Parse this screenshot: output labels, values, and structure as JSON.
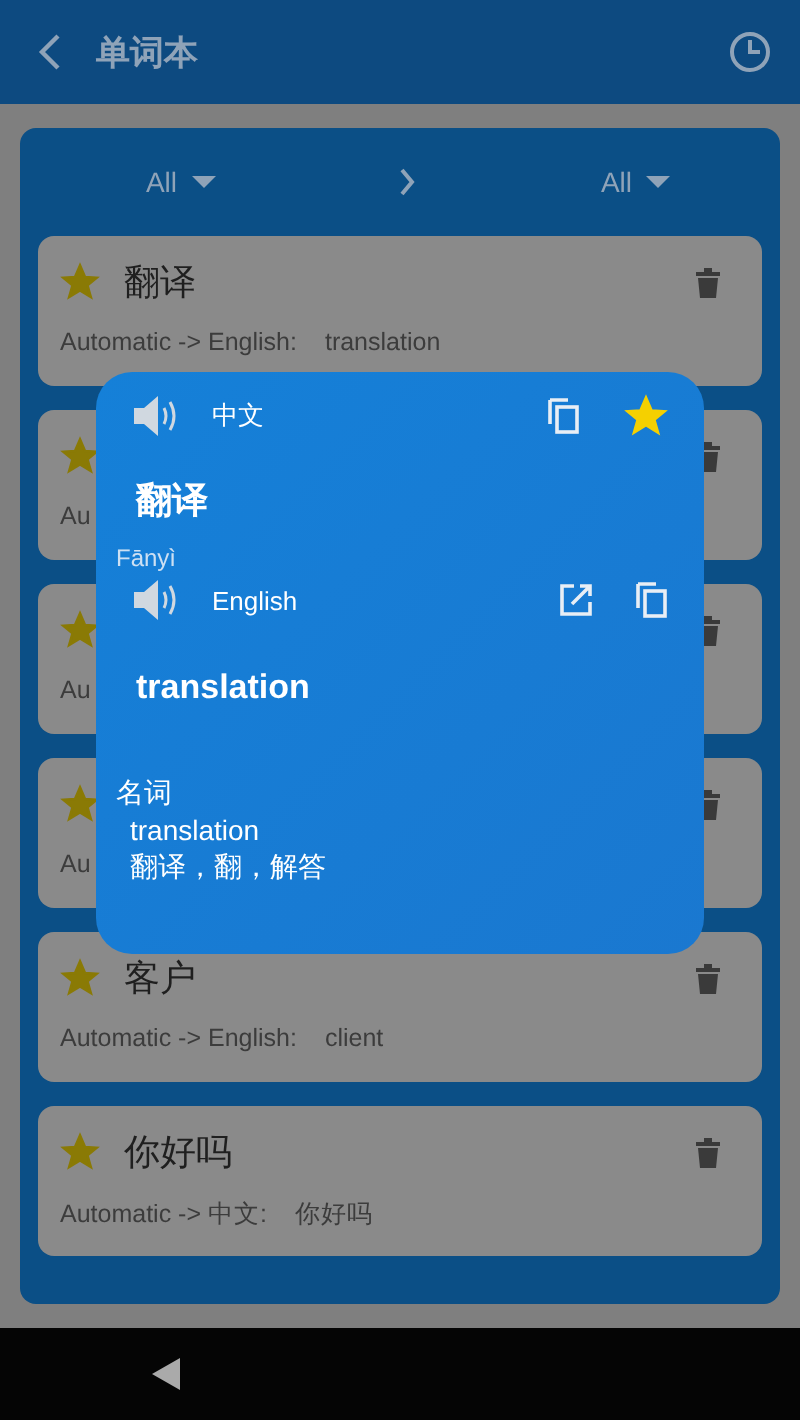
{
  "header": {
    "title": "单词本"
  },
  "filter": {
    "source": "All",
    "target": "All"
  },
  "words": [
    {
      "word": "翻译",
      "route": "Automatic -> English:",
      "meaning": "translation",
      "starred": true
    },
    {
      "route": "Au",
      "starred": true
    },
    {
      "route": "Au",
      "starred": true
    },
    {
      "route": "Au",
      "starred": true
    },
    {
      "word": "客户",
      "route": "Automatic -> English:",
      "meaning": "client",
      "starred": true
    },
    {
      "word": "你好吗",
      "route": "Automatic -> 中文:",
      "meaning": "你好吗",
      "starred": true
    }
  ],
  "popup": {
    "source_language": "中文",
    "starred": true,
    "word": "翻译",
    "pinyin": "Fānyì",
    "target_language": "English",
    "translation": "translation",
    "part_of_speech": "名词",
    "definition_word": "translation",
    "definition_meanings": "翻译，翻，解答"
  }
}
